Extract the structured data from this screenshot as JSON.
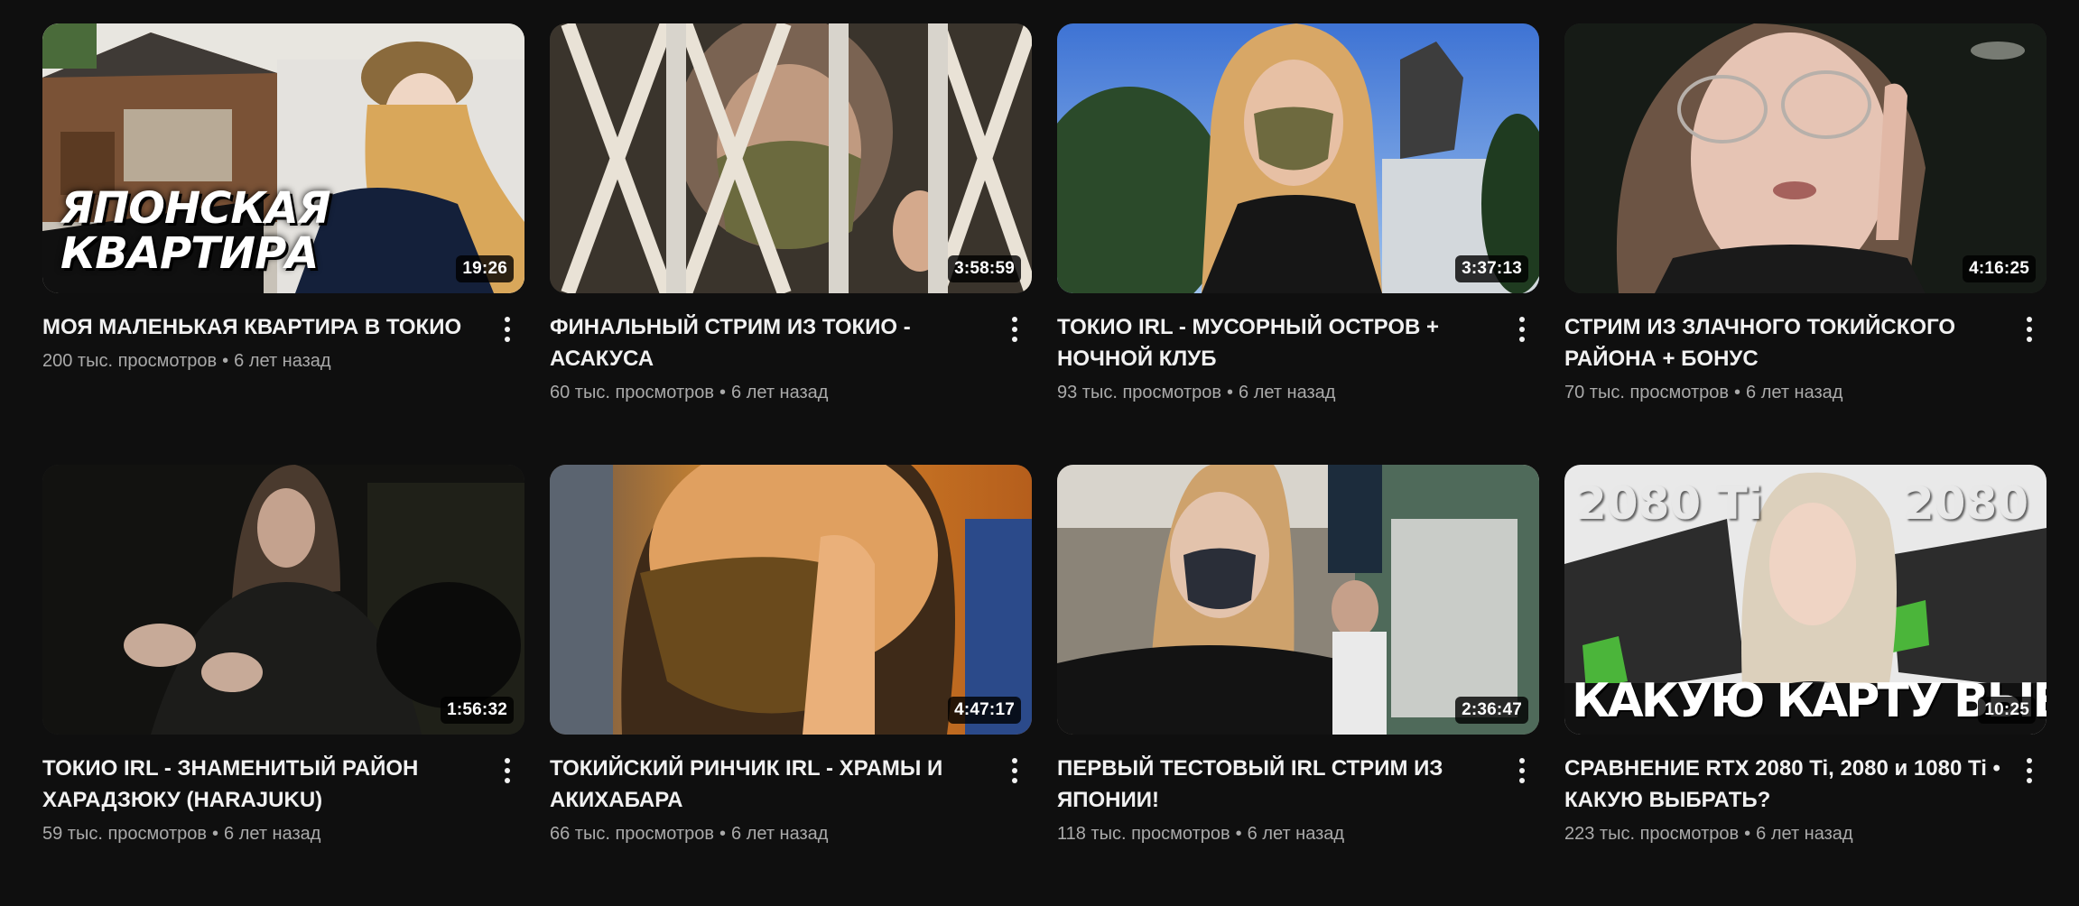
{
  "videos": [
    {
      "title": "МОЯ МАЛЕНЬКАЯ КВАРТИРА В ТОКИО",
      "views": "200 тыс. просмотров",
      "age": "6 лет назад",
      "duration": "19:26",
      "thumb_text": [
        "ЯПОНСКАЯ",
        "КВАРТИРА"
      ]
    },
    {
      "title": "ФИНАЛЬНЫЙ СТРИМ ИЗ ТОКИО - АСАКУСА",
      "views": "60 тыс. просмотров",
      "age": "6 лет назад",
      "duration": "3:58:59"
    },
    {
      "title": "ТОКИО IRL - МУСОРНЫЙ ОСТРОВ + НОЧНОЙ КЛУБ",
      "views": "93 тыс. просмотров",
      "age": "6 лет назад",
      "duration": "3:37:13"
    },
    {
      "title": "СТРИМ ИЗ ЗЛАЧНОГО ТОКИЙСКОГО РАЙОНА + БОНУС",
      "views": "70 тыс. просмотров",
      "age": "6 лет назад",
      "duration": "4:16:25"
    },
    {
      "title": "ТОКИО IRL - ЗНАМЕНИТЫЙ РАЙОН ХАРАДЗЮКУ (HARAJUKU)",
      "views": "59 тыс. просмотров",
      "age": "6 лет назад",
      "duration": "1:56:32"
    },
    {
      "title": "ТОКИЙСКИЙ РИНЧИК IRL - ХРАМЫ И АКИХАБАРА",
      "views": "66 тыс. просмотров",
      "age": "6 лет назад",
      "duration": "4:47:17"
    },
    {
      "title": "ПЕРВЫЙ ТЕСТОВЫЙ IRL СТРИМ ИЗ ЯПОНИИ!",
      "views": "118 тыс. просмотров",
      "age": "6 лет назад",
      "duration": "2:36:47"
    },
    {
      "title": "СРАВНЕНИЕ RTX 2080 Ti, 2080 и 1080 Ti • КАКУЮ ВЫБРАТЬ?",
      "views": "223 тыс. просмотров",
      "age": "6 лет назад",
      "duration": "10:25",
      "thumb_text": [
        "2080 Ti",
        "2080",
        "КАКУЮ КАРТУ ВЫБРАТЬ?"
      ]
    }
  ],
  "separator": "•",
  "icons": {
    "menu": "more-vert-icon"
  },
  "colors": {
    "background": "#0f0f0f",
    "title": "#f1f1f1",
    "meta": "#aaaaaa",
    "duration_bg": "#000000"
  }
}
